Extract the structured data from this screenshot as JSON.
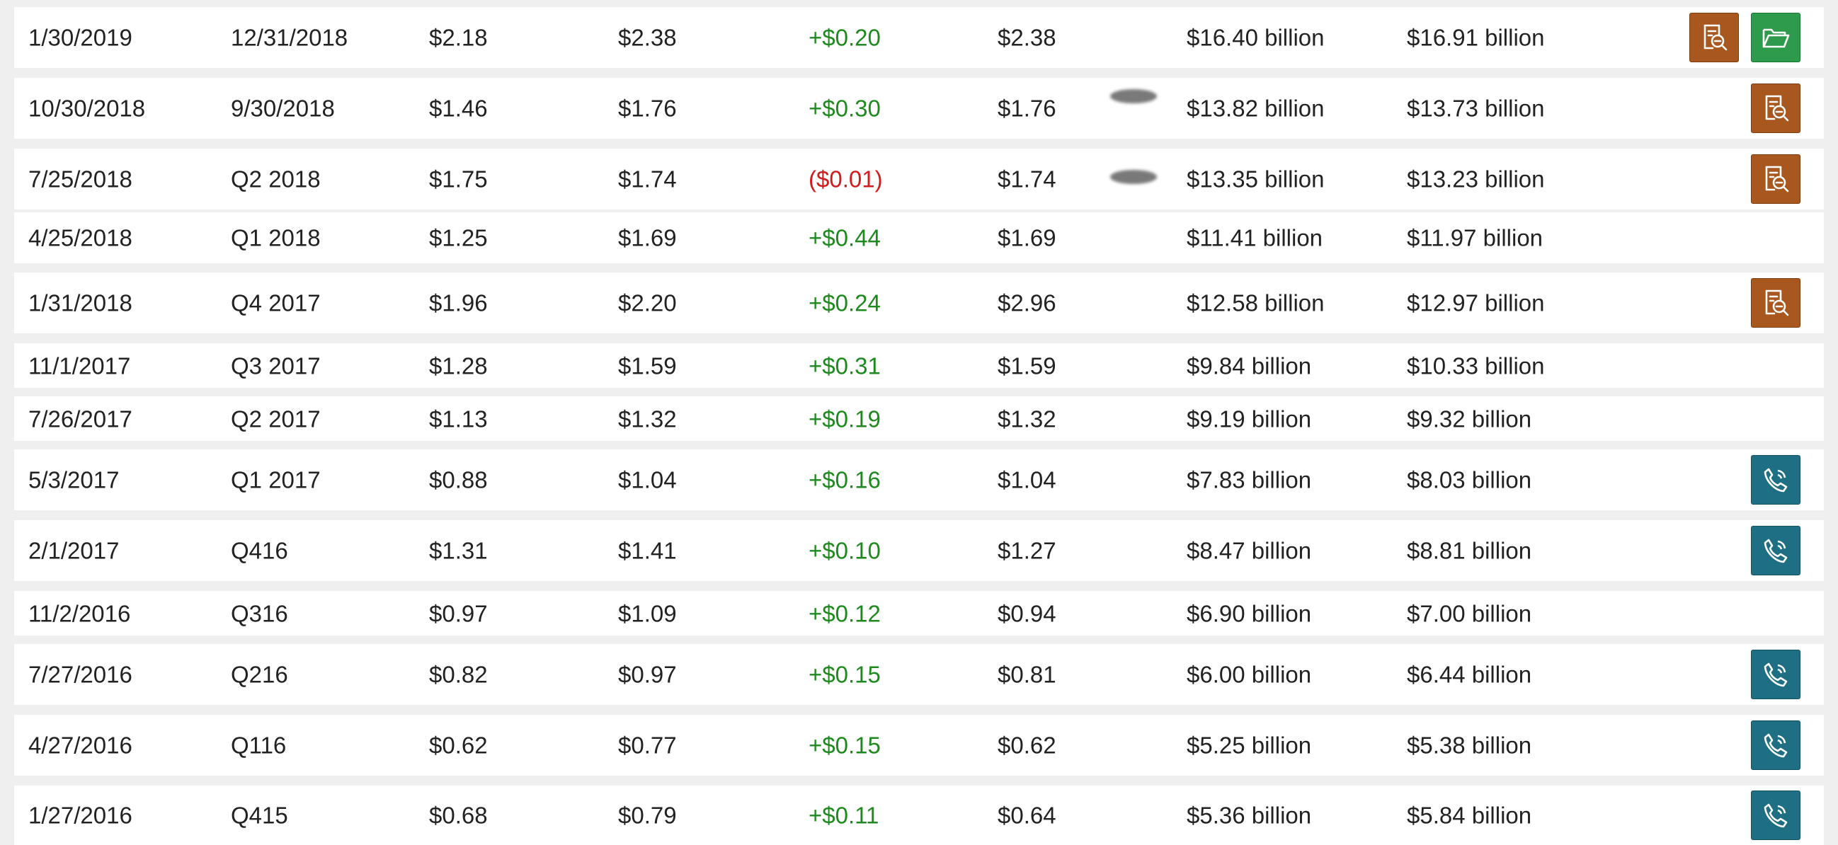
{
  "icons": {
    "report": "document-search-icon",
    "folder": "open-folder-icon",
    "call": "phone-icon"
  },
  "colors": {
    "positive": "#1e8a1e",
    "negative": "#d01c1c",
    "report_button": "#a8571e",
    "folder_button": "#2d9b4b",
    "call_button": "#1e6f84"
  },
  "rows": [
    {
      "date": "1/30/2019",
      "period": "12/31/2018",
      "consensus": "$2.18",
      "reported": "$2.38",
      "surprise": "+$0.20",
      "surprise_sign": "pos",
      "gaap": "$2.38",
      "rev_consensus": "$16.40 billion",
      "rev_actual": "$16.91 billion",
      "buttons": [
        "report",
        "folder"
      ],
      "blurred": false
    },
    {
      "date": "10/30/2018",
      "period": "9/30/2018",
      "consensus": "$1.46",
      "reported": "$1.76",
      "surprise": "+$0.30",
      "surprise_sign": "pos",
      "gaap": "$1.76",
      "rev_consensus": "$13.82 billion",
      "rev_actual": "$13.73 billion",
      "buttons": [
        "report"
      ],
      "blurred": true
    },
    {
      "date": "7/25/2018",
      "period": "Q2 2018",
      "consensus": "$1.75",
      "reported": "$1.74",
      "surprise": "($0.01)",
      "surprise_sign": "neg",
      "gaap": "$1.74",
      "rev_consensus": "$13.35 billion",
      "rev_actual": "$13.23 billion",
      "buttons": [
        "report"
      ],
      "blurred": true
    },
    {
      "date": "4/25/2018",
      "period": "Q1 2018",
      "consensus": "$1.25",
      "reported": "$1.69",
      "surprise": "+$0.44",
      "surprise_sign": "pos",
      "gaap": "$1.69",
      "rev_consensus": "$11.41 billion",
      "rev_actual": "$11.97 billion",
      "buttons": [],
      "blurred": false
    },
    {
      "date": "1/31/2018",
      "period": "Q4 2017",
      "consensus": "$1.96",
      "reported": "$2.20",
      "surprise": "+$0.24",
      "surprise_sign": "pos",
      "gaap": "$2.96",
      "rev_consensus": "$12.58 billion",
      "rev_actual": "$12.97 billion",
      "buttons": [
        "report"
      ],
      "blurred": false
    },
    {
      "date": "11/1/2017",
      "period": "Q3 2017",
      "consensus": "$1.28",
      "reported": "$1.59",
      "surprise": "+$0.31",
      "surprise_sign": "pos",
      "gaap": "$1.59",
      "rev_consensus": "$9.84 billion",
      "rev_actual": "$10.33 billion",
      "buttons": [],
      "blurred": false
    },
    {
      "date": "7/26/2017",
      "period": "Q2 2017",
      "consensus": "$1.13",
      "reported": "$1.32",
      "surprise": "+$0.19",
      "surprise_sign": "pos",
      "gaap": "$1.32",
      "rev_consensus": "$9.19 billion",
      "rev_actual": "$9.32 billion",
      "buttons": [],
      "blurred": false
    },
    {
      "date": "5/3/2017",
      "period": "Q1 2017",
      "consensus": "$0.88",
      "reported": "$1.04",
      "surprise": "+$0.16",
      "surprise_sign": "pos",
      "gaap": "$1.04",
      "rev_consensus": "$7.83 billion",
      "rev_actual": "$8.03 billion",
      "buttons": [
        "call"
      ],
      "blurred": false
    },
    {
      "date": "2/1/2017",
      "period": "Q416",
      "consensus": "$1.31",
      "reported": "$1.41",
      "surprise": "+$0.10",
      "surprise_sign": "pos",
      "gaap": "$1.27",
      "rev_consensus": "$8.47 billion",
      "rev_actual": "$8.81 billion",
      "buttons": [
        "call"
      ],
      "blurred": false
    },
    {
      "date": "11/2/2016",
      "period": "Q316",
      "consensus": "$0.97",
      "reported": "$1.09",
      "surprise": "+$0.12",
      "surprise_sign": "pos",
      "gaap": "$0.94",
      "rev_consensus": "$6.90 billion",
      "rev_actual": "$7.00 billion",
      "buttons": [],
      "blurred": false
    },
    {
      "date": "7/27/2016",
      "period": "Q216",
      "consensus": "$0.82",
      "reported": "$0.97",
      "surprise": "+$0.15",
      "surprise_sign": "pos",
      "gaap": "$0.81",
      "rev_consensus": "$6.00 billion",
      "rev_actual": "$6.44 billion",
      "buttons": [
        "call"
      ],
      "blurred": false
    },
    {
      "date": "4/27/2016",
      "period": "Q116",
      "consensus": "$0.62",
      "reported": "$0.77",
      "surprise": "+$0.15",
      "surprise_sign": "pos",
      "gaap": "$0.62",
      "rev_consensus": "$5.25 billion",
      "rev_actual": "$5.38 billion",
      "buttons": [
        "call"
      ],
      "blurred": false
    },
    {
      "date": "1/27/2016",
      "period": "Q415",
      "consensus": "$0.68",
      "reported": "$0.79",
      "surprise": "+$0.11",
      "surprise_sign": "pos",
      "gaap": "$0.64",
      "rev_consensus": "$5.36 billion",
      "rev_actual": "$5.84 billion",
      "buttons": [
        "call"
      ],
      "blurred": false
    }
  ]
}
